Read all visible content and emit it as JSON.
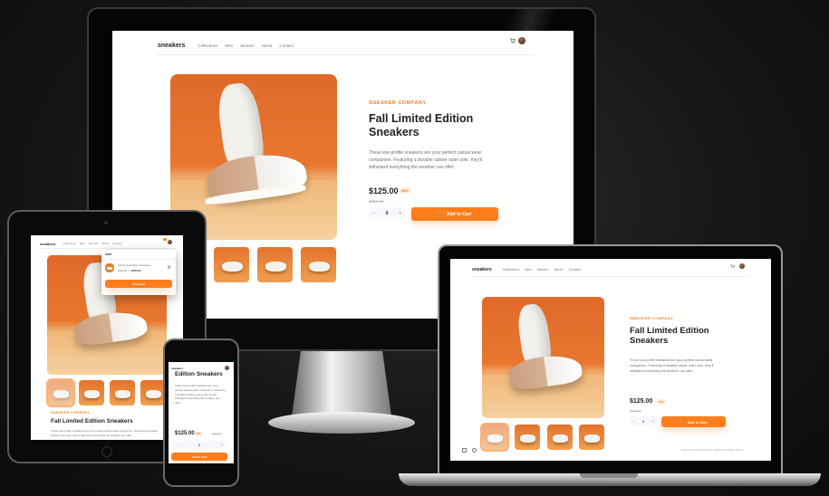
{
  "brand": "sneakers",
  "nav": [
    "Collections",
    "Men",
    "Women",
    "About",
    "Contact"
  ],
  "product": {
    "company": "SNEAKER COMPANY",
    "title": "Fall Limited Edition Sneakers",
    "title_line1": "Fall Limited Edition",
    "title_line2": "Sneakers",
    "mobile_title": "Edition Sneakers",
    "description": "These low-profile sneakers are your perfect casual wear companion. Featuring a durable rubber outer sole, they'll withstand everything the weather can offer.",
    "price": "$125.00",
    "discount": "50%",
    "old_price": "$250.00",
    "quantity": "0",
    "add_to_cart": "Add to Cart"
  },
  "tablet": {
    "quantity": "1"
  },
  "mobile": {
    "quantity": "1"
  },
  "laptop": {
    "quantity": "1"
  },
  "cart": {
    "title": "Cart",
    "item_name": "Fall Limited Edition Sneakers",
    "item_price": "$125.00 x 3",
    "item_total": "$375.00",
    "checkout": "Checkout"
  },
  "footer_note": "Challenge by Frontend Mentor. Coded by Bhupinder SINGH",
  "colors": {
    "accent": "#ff7d1a",
    "accent_pale": "#ffede0",
    "text_dark": "#1d2026",
    "text_grey": "#69707d"
  },
  "icons": [
    "cart-icon",
    "avatar",
    "minus-icon",
    "plus-icon",
    "delete-icon",
    "github-icon",
    "linkedin-icon"
  ]
}
